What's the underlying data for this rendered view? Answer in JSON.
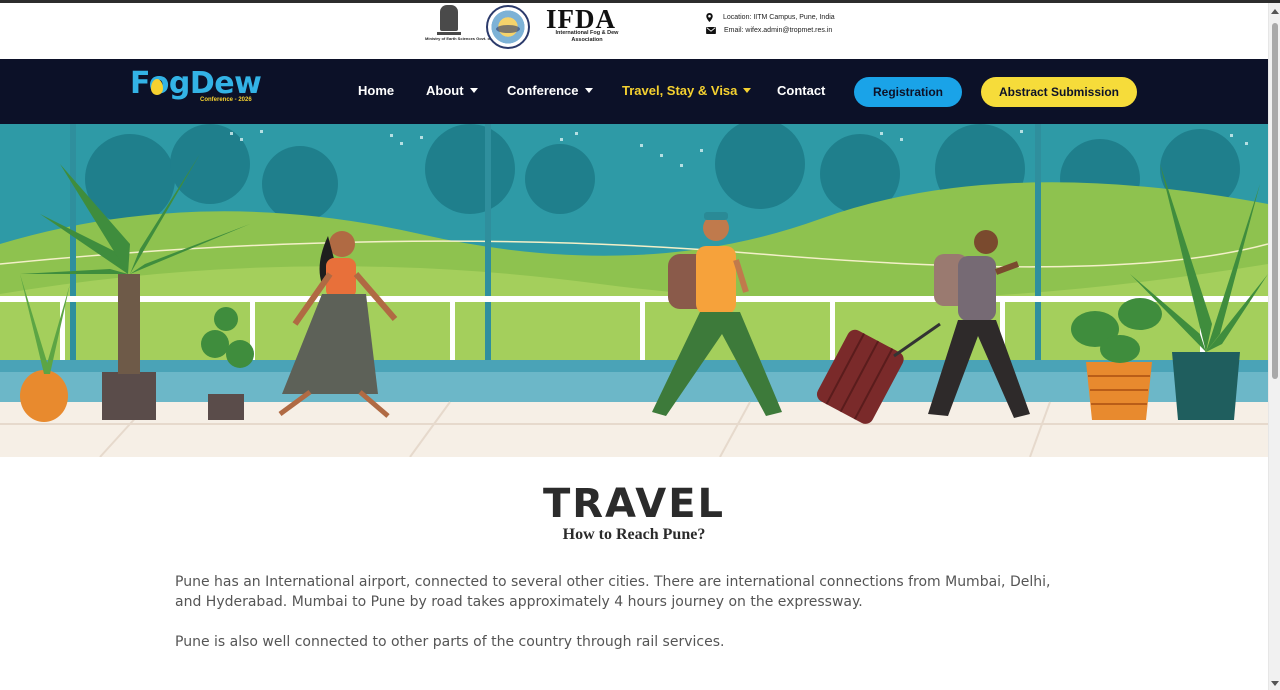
{
  "header": {
    "ministry_text": "Ministry of Earth Sciences Govt. of India",
    "org_name": "IFDA",
    "org_subtitle": "International Fog & Dew Association",
    "location": "Location: IITM Campus, Pune, India",
    "email": "Email: wifex.admin@tropmet.res.in"
  },
  "logo": {
    "name": "FogDew",
    "tagline": "Conference - 2026"
  },
  "nav": {
    "items": [
      {
        "label": "Home"
      },
      {
        "label": "About"
      },
      {
        "label": "Conference"
      },
      {
        "label": "Travel, Stay & Visa"
      },
      {
        "label": "Contact"
      }
    ],
    "registration_label": "Registration",
    "abstract_label": "Abstract Submission"
  },
  "main": {
    "title": "TRAVEL",
    "subtitle": "How to Reach Pune?",
    "paragraphs": [
      "Pune has an International airport, connected to several other cities. There are international connections from Mumbai, Delhi, and Hyderabad. Mumbai to Pune by road takes approximately 4 hours journey on the expressway.",
      "Pune is also well connected to other parts of the country through rail services."
    ]
  },
  "colors": {
    "nav_bg": "#0c1128",
    "accent_blue": "#1aa3e8",
    "accent_yellow": "#f6dc3a"
  }
}
